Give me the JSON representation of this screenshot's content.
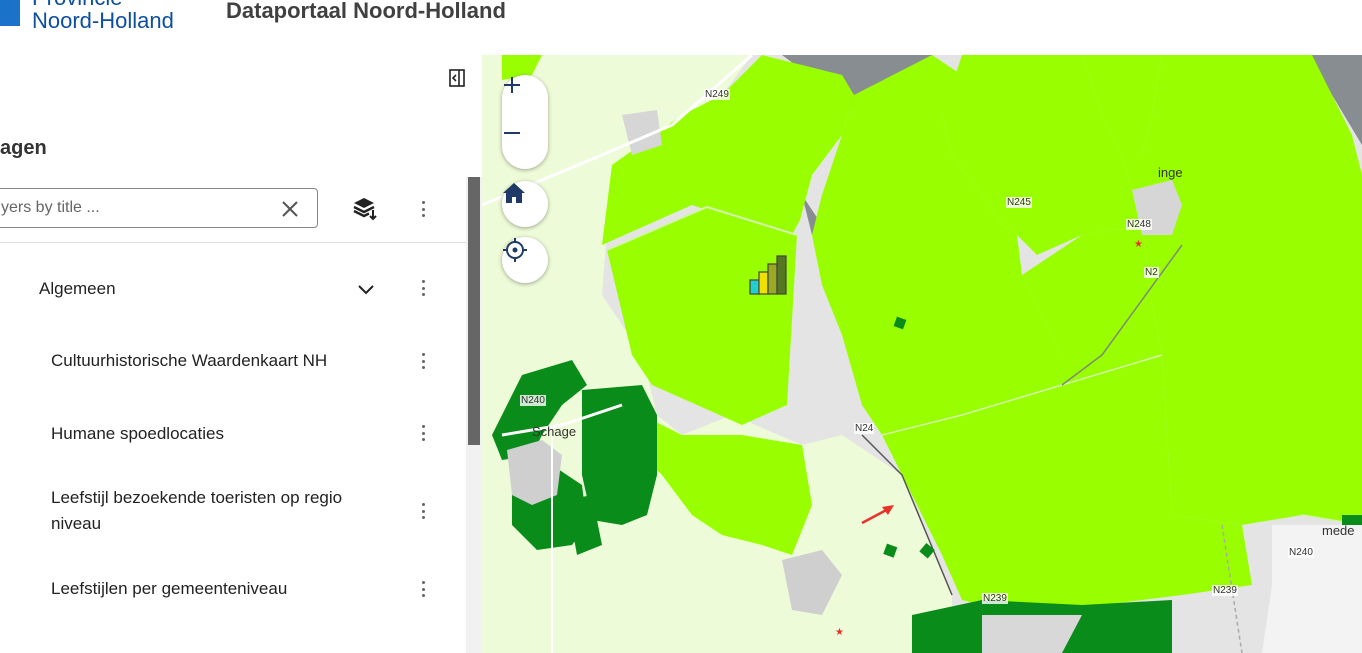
{
  "header": {
    "logo_line1": "Provincie",
    "logo_line2": "Noord-Holland",
    "app_title": "Dataportaal Noord-Holland"
  },
  "sidebar": {
    "title": "agen",
    "search_placeholder": "yers by title ...",
    "group": "Algemeen",
    "items": [
      {
        "label": "Cultuurhistorische Waardenkaart NH"
      },
      {
        "label": "Humane spoedlocaties"
      },
      {
        "label": "Leefstijl bezoekende toeristen op regio niveau"
      },
      {
        "label": "Leefstijlen per gemeenteniveau"
      }
    ]
  },
  "map": {
    "place_labels": [
      "Schage",
      "inge",
      "mede"
    ],
    "road_labels": [
      "N249",
      "N248",
      "N240",
      "N24",
      "N2",
      "N240",
      "N239",
      "N239",
      "N245"
    ],
    "colors": {
      "bright_green": "#99ff00",
      "dark_green": "#0a8c1a",
      "mid_green": "#22b022",
      "pale_green": "#eefbd8",
      "water": "#878d91"
    }
  },
  "icons": [
    "logo-icon",
    "collapse-panel-icon",
    "clear-icon",
    "layers-stack-icon",
    "more-vertical-icon",
    "chevron-down-icon",
    "zoom-in-icon",
    "zoom-out-icon",
    "home-icon",
    "locate-icon",
    "signal-bars-icon",
    "arrow-icon"
  ]
}
